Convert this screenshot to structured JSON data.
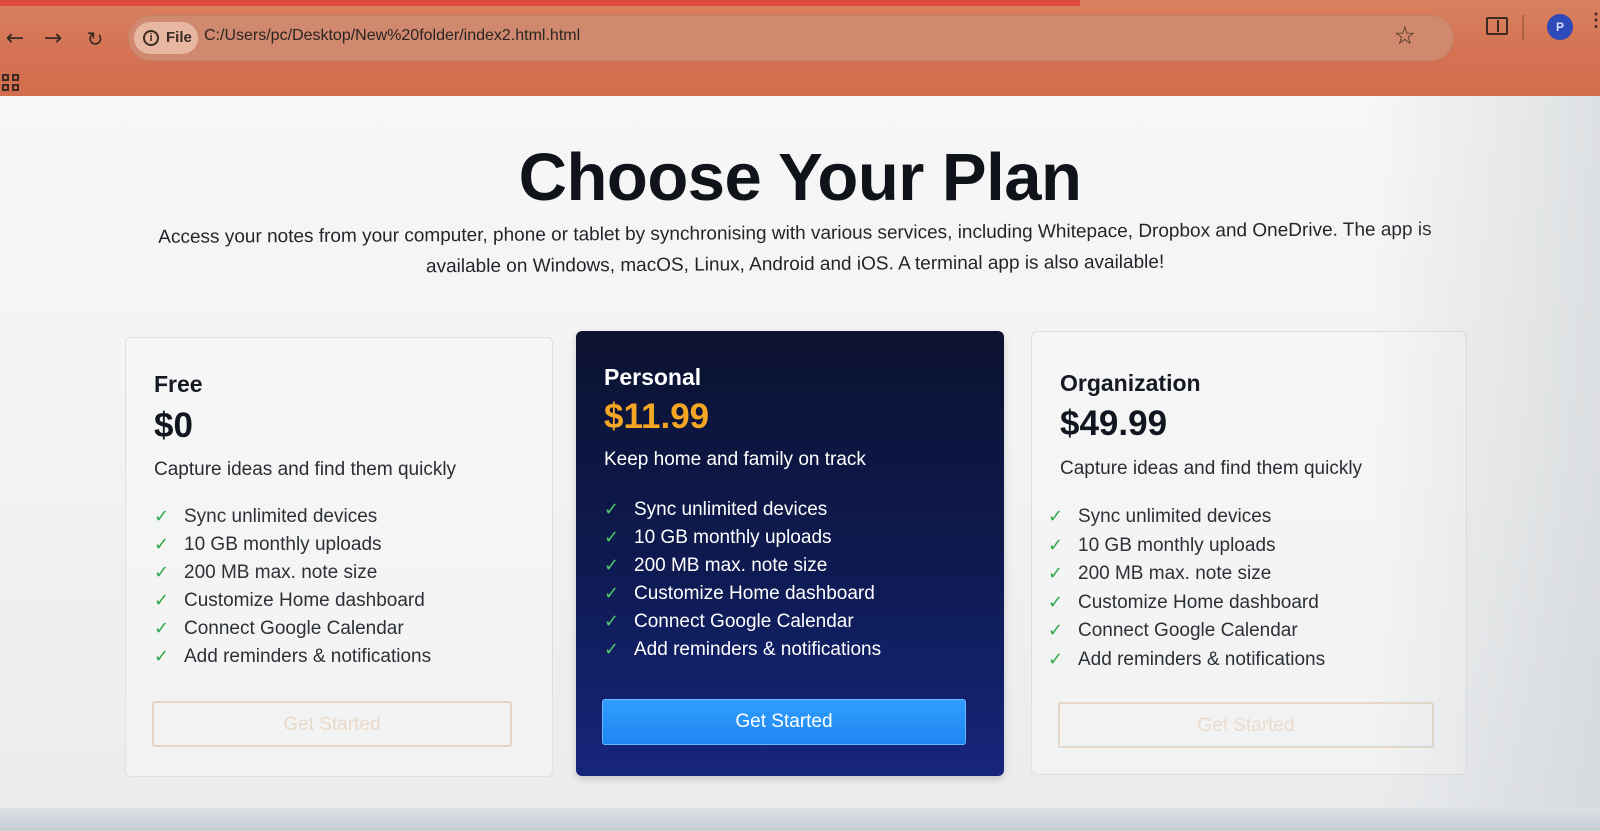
{
  "browser": {
    "file_label": "File",
    "url": "C:/Users/pc/Desktop/New%20folder/index2.html.html",
    "icons": {
      "back": "back-arrow-icon",
      "forward": "forward-arrow-icon",
      "reload": "reload-icon",
      "info": "info-icon",
      "star": "star-icon",
      "reader": "reader-mode-icon",
      "avatar": "profile-avatar",
      "menu": "more-options-icon",
      "apps": "apps-icon"
    },
    "avatar_initial": "P"
  },
  "page": {
    "title": "Choose Your Plan",
    "subtitle": "Access your notes from your computer, phone or tablet by synchronising with various services, including Whitepace, Dropbox and OneDrive. The app is available on Windows, macOS, Linux, Android and iOS. A terminal app is also available!"
  },
  "plans": [
    {
      "name": "Free",
      "price": "$0",
      "description": "Capture ideas and find them quickly",
      "features": [
        "Sync unlimited devices",
        "10 GB monthly uploads",
        "200 MB max. note size",
        "Customize Home dashboard",
        "Connect Google Calendar",
        "Add reminders & notifications"
      ],
      "cta": "Get Started"
    },
    {
      "name": "Personal",
      "price": "$11.99",
      "description": "Keep home and family on track",
      "features": [
        "Sync unlimited devices",
        "10 GB monthly uploads",
        "200 MB max. note size",
        "Customize Home dashboard",
        "Connect Google Calendar",
        "Add reminders & notifications"
      ],
      "cta": "Get Started"
    },
    {
      "name": "Organization",
      "price": "$49.99",
      "description": "Capture ideas and find them quickly",
      "features": [
        "Sync unlimited devices",
        "10 GB monthly uploads",
        "200 MB max. note size",
        "Customize Home dashboard",
        "Connect Google Calendar",
        "Add reminders & notifications"
      ],
      "cta": "Get Started"
    }
  ],
  "symbols": {
    "back": "←",
    "forward": "→",
    "reload": "↻",
    "star": "☆",
    "check": "✓",
    "info": "i",
    "menu": "⋮"
  },
  "colors": {
    "browser_accent": "#d47353",
    "featured_card": "#0e1a50",
    "featured_price": "#f5a623",
    "primary_button": "#1f86f1",
    "check_green": "#31a84a"
  }
}
